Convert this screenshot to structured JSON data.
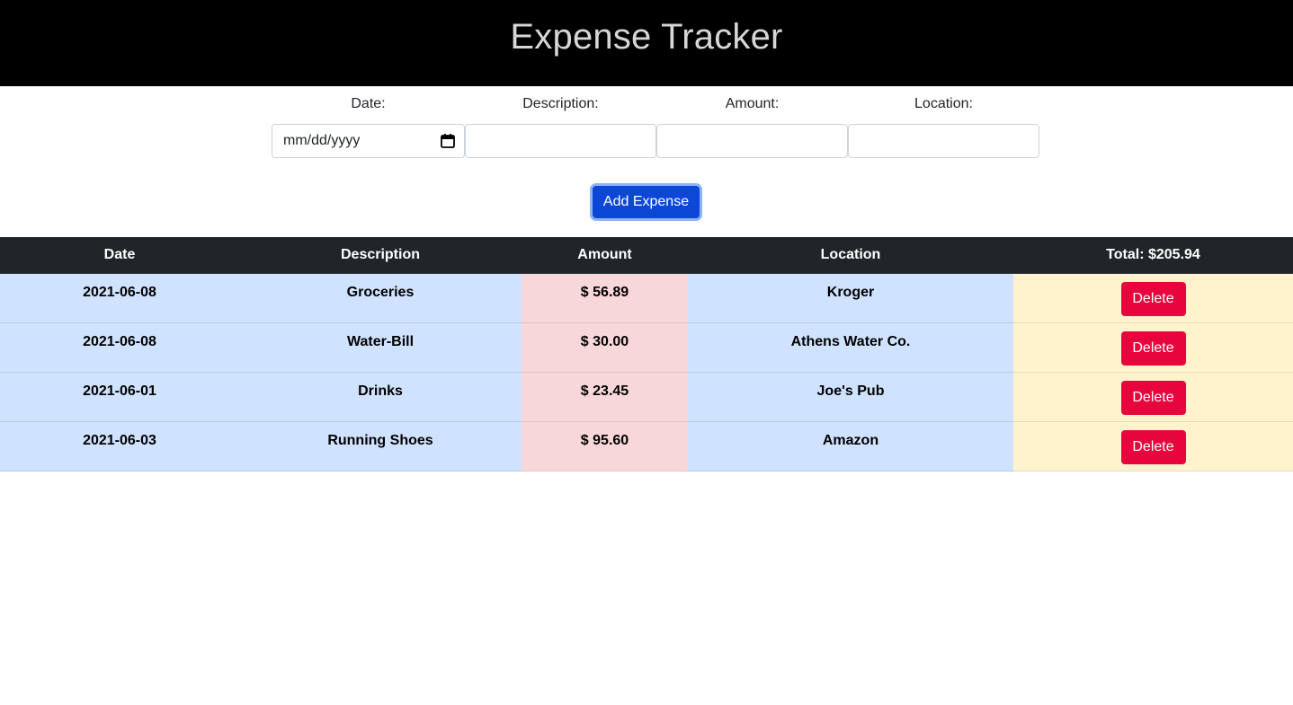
{
  "header": {
    "title": "Expense Tracker"
  },
  "form": {
    "date_label": "Date:",
    "date_placeholder": "mm/dd/yyyy",
    "description_label": "Description:",
    "amount_label": "Amount:",
    "location_label": "Location:",
    "add_button": "Add Expense"
  },
  "table": {
    "headers": {
      "date": "Date",
      "description": "Description",
      "amount": "Amount",
      "location": "Location",
      "total": "Total: $205.94"
    },
    "rows": [
      {
        "date": "2021-06-08",
        "description": "Groceries",
        "amount": "$ 56.89",
        "location": "Kroger",
        "action": "Delete"
      },
      {
        "date": "2021-06-08",
        "description": "Water-Bill",
        "amount": "$ 30.00",
        "location": "Athens Water Co.",
        "action": "Delete"
      },
      {
        "date": "2021-06-01",
        "description": "Drinks",
        "amount": "$ 23.45",
        "location": "Joe's Pub",
        "action": "Delete"
      },
      {
        "date": "2021-06-03",
        "description": "Running Shoes",
        "amount": "$ 95.60",
        "location": "Amazon",
        "action": "Delete"
      }
    ]
  },
  "colors": {
    "header_bg": "#000000",
    "title_text": "#d6d6d6",
    "primary_button": "#0d47d6",
    "table_header_bg": "#212529",
    "row_blue": "#cfe2ff",
    "amount_pink": "#f8d7da",
    "action_yellow": "#fff3cd",
    "delete_button": "#e8043d"
  },
  "icons": {
    "date_picker": "calendar-icon"
  }
}
